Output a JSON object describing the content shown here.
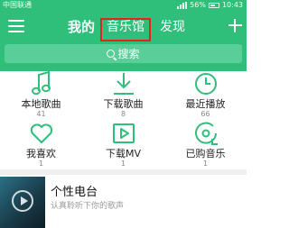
{
  "status_bar": {
    "carrier": "中国联通",
    "battery": "56%",
    "time": "10:43"
  },
  "nav": {
    "tab_me": "我的",
    "tab_music_hall": "音乐馆",
    "tab_discover": "发现"
  },
  "search": {
    "label": "搜索"
  },
  "grid": [
    {
      "label": "本地歌曲",
      "count": "41"
    },
    {
      "label": "下载歌曲",
      "count": "8"
    },
    {
      "label": "最近播放",
      "count": "66"
    },
    {
      "label": "我喜欢",
      "count": "1"
    },
    {
      "label": "下载MV",
      "count": "1"
    },
    {
      "label": "已购音乐",
      "count": "1"
    }
  ],
  "radio": {
    "title": "个性电台",
    "subtitle": "认真聆听下你的歌声"
  },
  "colors": {
    "brand": "#2fbf7b",
    "highlight": "#e0251b"
  }
}
